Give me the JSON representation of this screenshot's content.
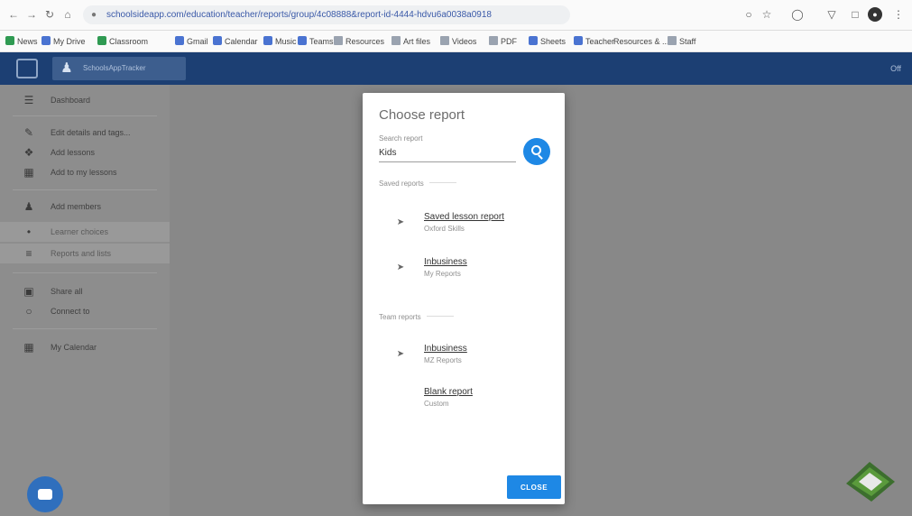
{
  "browser": {
    "url": "schoolsideapp.com/education/teacher/reports/group/4c08888&report-id-4444-hdvu6a0038a0918",
    "bookmarks": [
      "News",
      "My Drive",
      "Classroom",
      "Gmail",
      "Calendar",
      "Music",
      "Teams",
      "Resources",
      "Art files",
      "Videos",
      "PDF",
      "Sheets",
      "Teacher",
      "Resources & ...",
      "Staff"
    ]
  },
  "app": {
    "logo_text": "SchoolsAppTracker",
    "user": "Off"
  },
  "sidebar": {
    "items": [
      {
        "icon": "menu-icon",
        "label": "Dashboard"
      },
      {
        "icon": "pencil-icon",
        "label": "Edit details and tags..."
      },
      {
        "icon": "puzzle-icon",
        "label": "Add lessons"
      },
      {
        "icon": "calendar-icon",
        "label": "Add to my lessons"
      },
      {
        "icon": "people-icon",
        "label": "Add members"
      },
      {
        "icon": "dot-icon",
        "label": "Learner choices"
      },
      {
        "icon": "chart-icon",
        "label": "Reports and lists"
      },
      {
        "icon": "share-icon",
        "label": "Share all"
      },
      {
        "icon": "copy-icon",
        "label": "Connect to"
      },
      {
        "icon": "calendar-icon",
        "label": "My Calendar"
      }
    ]
  },
  "modal": {
    "title": "Choose report",
    "search_label": "Search report",
    "search_value": "Kids",
    "sections": [
      {
        "header": "Saved reports",
        "reports": [
          {
            "name": "Saved lesson report",
            "sub": "Oxford Skills"
          },
          {
            "name": "Inbusiness",
            "sub": "My Reports"
          }
        ]
      },
      {
        "header": "Team reports",
        "reports": [
          {
            "name": "Inbusiness",
            "sub": "MZ Reports"
          },
          {
            "name": "Blank report",
            "sub": "Custom"
          }
        ]
      }
    ],
    "close_label": "CLOSE"
  },
  "colors": {
    "app_header": "#1c3f73",
    "accent": "#1e88e5",
    "overlay": "#888888"
  }
}
